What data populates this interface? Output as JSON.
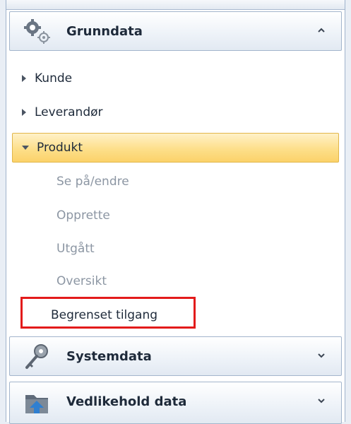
{
  "groups": {
    "grunndata": {
      "title": "Grunndata",
      "icon": "gears-icon",
      "state": "expanded"
    },
    "systemdata": {
      "title": "Systemdata",
      "icon": "key-icon",
      "state": "collapsed"
    },
    "vedlikehold": {
      "title": "Vedlikehold data",
      "icon": "folder-arrow-icon",
      "state": "collapsed"
    }
  },
  "nav": {
    "kunde": "Kunde",
    "leverandor": "Leverandør",
    "produkt": "Produkt"
  },
  "produkt_items": {
    "se_pa_endre": "Se på/endre",
    "opprette": "Opprette",
    "utgatt": "Utgått",
    "oversikt": "Oversikt",
    "begrenset_tilgang": "Begrenset tilgang"
  },
  "colors": {
    "selected_fill": "#fddf8a",
    "highlight_border": "#e31b1b",
    "disabled_text": "#8c96a3"
  }
}
